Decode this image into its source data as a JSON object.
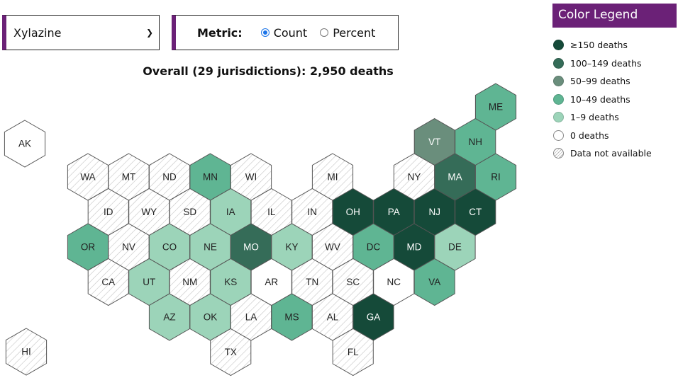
{
  "controls": {
    "substance_select": {
      "selected": "Xylazine"
    },
    "metric": {
      "label": "Metric:",
      "options": [
        {
          "label": "Count",
          "selected": true
        },
        {
          "label": "Percent",
          "selected": false
        }
      ]
    }
  },
  "summary": "Overall (29 jurisdictions): 2,950 deaths",
  "legend": {
    "title": "Color Legend",
    "items": [
      {
        "key": "ge150",
        "label": "≥150 deaths",
        "color": "#154a39"
      },
      {
        "key": "100_149",
        "label": "100–149 deaths",
        "color": "#356c58"
      },
      {
        "key": "50_99",
        "label": "50–99 deaths",
        "color": "#6a8e7c"
      },
      {
        "key": "10_49",
        "label": "10–49 deaths",
        "color": "#5fb593"
      },
      {
        "key": "1_9",
        "label": "1–9 deaths",
        "color": "#9cd4b9"
      },
      {
        "key": "0",
        "label": "0 deaths",
        "color": "#ffffff"
      },
      {
        "key": "na",
        "label": "Data not available",
        "color": "hatch"
      }
    ]
  },
  "states": [
    {
      "abbr": "ME",
      "row": -2,
      "col": 10,
      "cat": "10_49"
    },
    {
      "abbr": "VT",
      "row": -1,
      "col": 8,
      "cat": "50_99"
    },
    {
      "abbr": "NH",
      "row": -1,
      "col": 9,
      "cat": "10_49"
    },
    {
      "abbr": "WA",
      "row": 0,
      "col": 0,
      "cat": "na"
    },
    {
      "abbr": "MT",
      "row": 0,
      "col": 1,
      "cat": "na"
    },
    {
      "abbr": "ND",
      "row": 0,
      "col": 2,
      "cat": "na"
    },
    {
      "abbr": "MN",
      "row": 0,
      "col": 3,
      "cat": "10_49"
    },
    {
      "abbr": "WI",
      "row": 0,
      "col": 4,
      "cat": "na"
    },
    {
      "abbr": "MI",
      "row": 0,
      "col": 6,
      "cat": "na"
    },
    {
      "abbr": "NY",
      "row": 0,
      "col": 8,
      "cat": "na"
    },
    {
      "abbr": "MA",
      "row": 0,
      "col": 9,
      "cat": "100_149"
    },
    {
      "abbr": "RI",
      "row": 0,
      "col": 10,
      "cat": "10_49"
    },
    {
      "abbr": "ID",
      "row": 1,
      "col": 0,
      "cat": "na"
    },
    {
      "abbr": "WY",
      "row": 1,
      "col": 1,
      "cat": "na"
    },
    {
      "abbr": "SD",
      "row": 1,
      "col": 2,
      "cat": "na"
    },
    {
      "abbr": "IA",
      "row": 1,
      "col": 3,
      "cat": "1_9"
    },
    {
      "abbr": "IL",
      "row": 1,
      "col": 4,
      "cat": "na"
    },
    {
      "abbr": "IN",
      "row": 1,
      "col": 5,
      "cat": "na"
    },
    {
      "abbr": "OH",
      "row": 1,
      "col": 6,
      "cat": "ge150"
    },
    {
      "abbr": "PA",
      "row": 1,
      "col": 7,
      "cat": "ge150"
    },
    {
      "abbr": "NJ",
      "row": 1,
      "col": 8,
      "cat": "ge150"
    },
    {
      "abbr": "CT",
      "row": 1,
      "col": 9,
      "cat": "ge150"
    },
    {
      "abbr": "OR",
      "row": 2,
      "col": 0,
      "cat": "10_49"
    },
    {
      "abbr": "NV",
      "row": 2,
      "col": 1,
      "cat": "na"
    },
    {
      "abbr": "CO",
      "row": 2,
      "col": 2,
      "cat": "1_9"
    },
    {
      "abbr": "NE",
      "row": 2,
      "col": 3,
      "cat": "1_9"
    },
    {
      "abbr": "MO",
      "row": 2,
      "col": 4,
      "cat": "100_149"
    },
    {
      "abbr": "KY",
      "row": 2,
      "col": 5,
      "cat": "1_9"
    },
    {
      "abbr": "WV",
      "row": 2,
      "col": 6,
      "cat": "na"
    },
    {
      "abbr": "DC",
      "row": 2,
      "col": 7,
      "cat": "10_49"
    },
    {
      "abbr": "MD",
      "row": 2,
      "col": 8,
      "cat": "ge150"
    },
    {
      "abbr": "DE",
      "row": 2,
      "col": 9,
      "cat": "1_9"
    },
    {
      "abbr": "CA",
      "row": 3,
      "col": 0,
      "cat": "na"
    },
    {
      "abbr": "UT",
      "row": 3,
      "col": 1,
      "cat": "1_9"
    },
    {
      "abbr": "NM",
      "row": 3,
      "col": 2,
      "cat": "na"
    },
    {
      "abbr": "KS",
      "row": 3,
      "col": 3,
      "cat": "1_9"
    },
    {
      "abbr": "AR",
      "row": 3,
      "col": 4,
      "cat": "0"
    },
    {
      "abbr": "TN",
      "row": 3,
      "col": 5,
      "cat": "na"
    },
    {
      "abbr": "SC",
      "row": 3,
      "col": 6,
      "cat": "na"
    },
    {
      "abbr": "NC",
      "row": 3,
      "col": 7,
      "cat": "0"
    },
    {
      "abbr": "VA",
      "row": 3,
      "col": 8,
      "cat": "10_49"
    },
    {
      "abbr": "AZ",
      "row": 4,
      "col": 2,
      "cat": "1_9"
    },
    {
      "abbr": "OK",
      "row": 4,
      "col": 3,
      "cat": "1_9"
    },
    {
      "abbr": "LA",
      "row": 4,
      "col": 4,
      "cat": "na"
    },
    {
      "abbr": "MS",
      "row": 4,
      "col": 5,
      "cat": "10_49"
    },
    {
      "abbr": "AL",
      "row": 4,
      "col": 6,
      "cat": "na"
    },
    {
      "abbr": "GA",
      "row": 4,
      "col": 7,
      "cat": "ge150"
    },
    {
      "abbr": "TX",
      "row": 5,
      "col": 3,
      "cat": "na"
    },
    {
      "abbr": "FL",
      "row": 5,
      "col": 6,
      "cat": "na"
    }
  ],
  "offshore": [
    {
      "abbr": "AK",
      "slot": "top",
      "cat": "0"
    },
    {
      "abbr": "HI",
      "slot": "bottom",
      "cat": "na"
    }
  ]
}
